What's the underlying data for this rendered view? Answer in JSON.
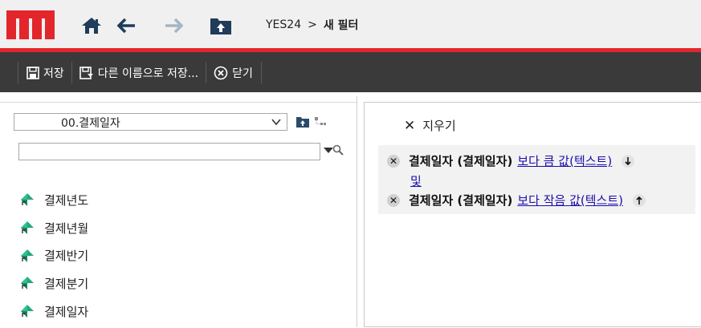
{
  "header": {
    "breadcrumb": {
      "root": "YES24",
      "separator": ">",
      "current": "새 필터"
    },
    "icons": [
      "home-icon",
      "back-arrow-icon",
      "forward-arrow-icon",
      "folder-up-icon"
    ]
  },
  "toolbar": {
    "save_label": "저장",
    "save_as_label": "다른 이름으로 저장...",
    "close_label": "닫기"
  },
  "left": {
    "folder_select_value": "00.결제일자",
    "search_value": "",
    "fields": [
      {
        "label": "결제년도"
      },
      {
        "label": "결제년월"
      },
      {
        "label": "결제반기"
      },
      {
        "label": "결제분기"
      },
      {
        "label": "결제일자"
      }
    ]
  },
  "right": {
    "clear_label": "지우기",
    "conditions": [
      {
        "field": "결제일자 (결제일자)",
        "operator": "보다 큼",
        "value": "값(텍스트)",
        "arrow": "down"
      },
      {
        "field": "결제일자 (결제일자)",
        "operator": "보다 작음",
        "value": "값(텍스트)",
        "arrow": "up"
      }
    ],
    "conjunction": "및"
  },
  "colors": {
    "brand_red": "#e3262c",
    "toolbar_bg": "#3a3a3a",
    "link": "#1a0dab",
    "accent_green": "#21a97a"
  }
}
